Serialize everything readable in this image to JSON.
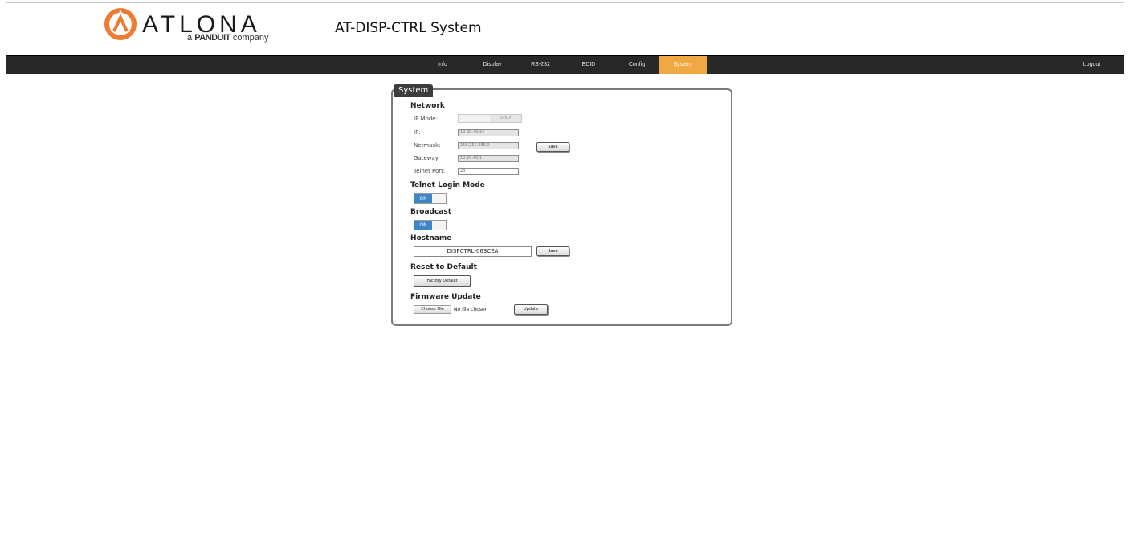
{
  "header": {
    "brand": "ATLONA",
    "tagline_prefix": "a",
    "tagline_brand": "PANDUIT",
    "tagline_suffix": "company",
    "page_title": "AT-DISP-CTRL  System"
  },
  "nav": {
    "items": [
      {
        "label": "Info"
      },
      {
        "label": "Display"
      },
      {
        "label": "RS-232"
      },
      {
        "label": "EDID"
      },
      {
        "label": "Config"
      },
      {
        "label": "System"
      }
    ],
    "active_index": 5,
    "logout_label": "Logout"
  },
  "colors": {
    "navbar_bg": "#282828",
    "active_tab": "#f0a843",
    "toggle_on": "#3f86c9",
    "logo_orange": "#ee7b30"
  },
  "system": {
    "legend": "System",
    "network": {
      "heading": "Network",
      "ip_mode_label": "IP Mode:",
      "ip_mode_options": [
        "",
        "DHCP"
      ],
      "ip_label": "IP:",
      "ip_value": "10.20.40.34",
      "netmask_label": "Netmask:",
      "netmask_value": "255.255.255.0",
      "gateway_label": "Gateway:",
      "gateway_value": "10.20.40.1",
      "telnet_port_label": "Telnet Port:",
      "telnet_port_value": "23",
      "save_label": "Save"
    },
    "telnet_login": {
      "heading": "Telnet Login Mode",
      "state": "ON"
    },
    "broadcast": {
      "heading": "Broadcast",
      "state": "ON"
    },
    "hostname": {
      "heading": "Hostname",
      "value": "DISPCTRL-063CEA",
      "save_label": "Save"
    },
    "reset": {
      "heading": "Reset to Default",
      "button_label": "Factory Default"
    },
    "firmware": {
      "heading": "Firmware Update",
      "choose_label": "Choose File",
      "status": "No file chosen",
      "update_label": "Update"
    }
  }
}
